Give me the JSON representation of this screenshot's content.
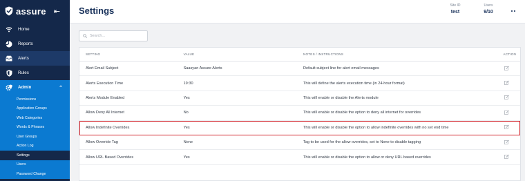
{
  "brand": {
    "name": "assure",
    "logo_icon": "shield-check-icon",
    "collapse_icon": "collapse-arrow-icon"
  },
  "sidebar": {
    "items": [
      {
        "label": "Home",
        "icon": "wifi-icon"
      },
      {
        "label": "Reports",
        "icon": "pie-chart-icon"
      },
      {
        "label": "Alerts",
        "icon": "inbox-icon"
      },
      {
        "label": "Rules",
        "icon": "shield-icon"
      },
      {
        "label": "Admin",
        "icon": "gear-shield-icon"
      }
    ],
    "submenu": [
      "Permissions",
      "Application Groups",
      "Web Categories",
      "Words & Phrases",
      "User Groups",
      "Action Log",
      "Settings",
      "Users",
      "Password Change"
    ]
  },
  "header": {
    "title": "Settings",
    "site_label": "Site ID",
    "site_value": "test",
    "users_label": "Users",
    "users_value": "9/10"
  },
  "search": {
    "placeholder": "Search..."
  },
  "table": {
    "columns": [
      "SETTING",
      "VALUE",
      "NOTES / INSTRUCTIONS",
      "ACTION"
    ],
    "rows": [
      {
        "setting": "Alert Email Subject",
        "value": "Saasyan Assure Alerts",
        "notes": "Default subject line for alert email messages"
      },
      {
        "setting": "Alerts Execution Time",
        "value": "19:30",
        "notes": "This will define the alerts execution time (in 24-hour format)"
      },
      {
        "setting": "Alerts Module Enabled",
        "value": "Yes",
        "notes": "This will enable or disable the Alerts module"
      },
      {
        "setting": "Allow Deny All Internet",
        "value": "No",
        "notes": "This will enable or disable the option to deny all internet for overrides"
      },
      {
        "setting": "Allow Indefinite Overrides",
        "value": "Yes",
        "notes": "This will enable or disable the option to allow indefinite overrides with no set end time"
      },
      {
        "setting": "Allow Override Tag",
        "value": "None",
        "notes": "Tag to be used for the allow overrides, set to None to disable tagging"
      },
      {
        "setting": "Allow URL Based Overrides",
        "value": "Yes",
        "notes": "This will enable or disable the option to allow or deny URL based overrides"
      }
    ],
    "highlighted_row": "Allow Indefinite Overrides",
    "action_icon": "edit-icon"
  },
  "colors": {
    "sidebar_bg": "#14284a",
    "active_section": "#0b7ad1",
    "title": "#18315a",
    "highlight_border": "#d2232a"
  }
}
